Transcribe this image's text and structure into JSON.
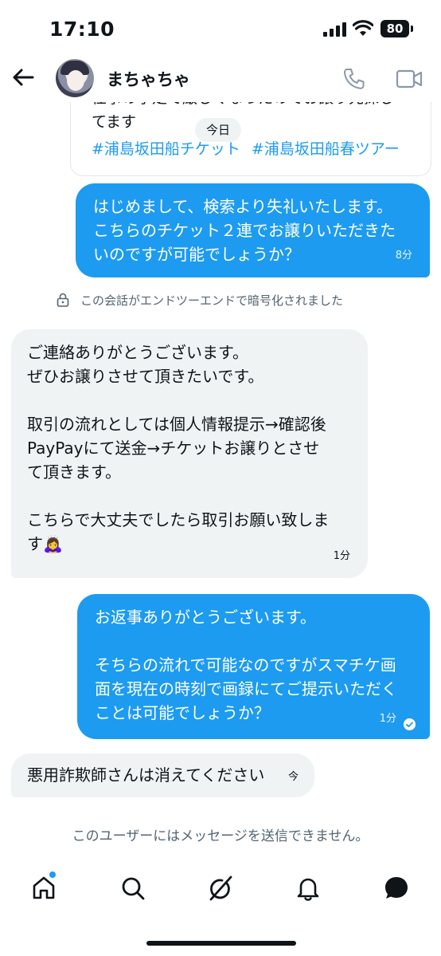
{
  "status_bar": {
    "time": "17:10",
    "battery": "80"
  },
  "header": {
    "contact_name": "まちゃちゃ"
  },
  "shared_card": {
    "text": "仕事の予定で厳しくなったのでお譲り先探し\nてます",
    "hashtags": [
      "#浦島坂田船チケット",
      "#浦島坂田船春ツアー"
    ]
  },
  "date_pill": "今日",
  "messages": [
    {
      "direction": "out",
      "text": "はじめまして、検索より失礼いたします。\nこちらのチケット２連でお譲りいただきた\nいのですが可能でしょうか？",
      "time": "8分"
    },
    {
      "direction": "in",
      "text": "ご連絡ありがとうございます。\nぜひお譲りさせて頂きたいです。\n\n取引の流れとしては個人情報提示→確認後\nPayPayにて送金→チケットお譲りとさせ\nて頂きます。\n\nこちらで大丈夫でしたら取引お願い致しま\nす🙇‍♀️",
      "time": "1分"
    },
    {
      "direction": "out",
      "text": "お返事ありがとうございます。\n\nそちらの流れで可能なのですがスマチケ画\n面を現在の時刻で画録にてご提示いただく\nことは可能でしょうか？",
      "time": "1分"
    },
    {
      "direction": "in",
      "text": "悪用詐欺師さんは消えてください",
      "time": "今"
    }
  ],
  "encryption_note": "この会話がエンドツーエンドで暗号化されました",
  "footer_notice": "このユーザーにはメッセージを送信できません。",
  "icons": {
    "back": "arrow-left-icon",
    "phone": "phone-icon",
    "video": "video-icon",
    "home": "home-icon",
    "search": "search-icon",
    "grok": "grok-icon",
    "notifications": "bell-icon",
    "messages": "message-icon"
  },
  "colors": {
    "accent": "#1d9bf0",
    "incoming_bubble": "#eff3f4",
    "secondary_text": "#536471"
  }
}
